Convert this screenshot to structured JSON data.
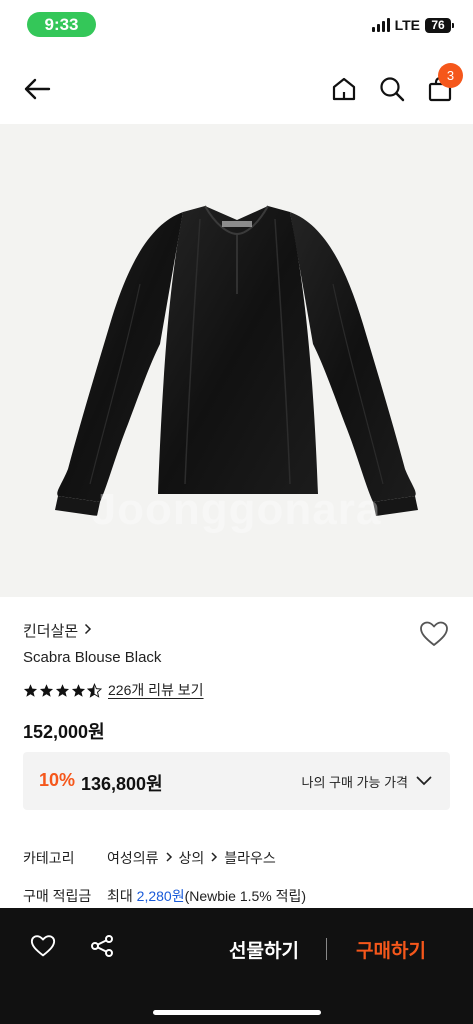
{
  "status_bar": {
    "time": "9:33",
    "network": "LTE",
    "battery": "76"
  },
  "header": {
    "cart_count": "3"
  },
  "image": {
    "watermark": "Joonggonara"
  },
  "product": {
    "brand": "킨더살몬",
    "name": "Scabra Blouse Black",
    "rating": 4.5,
    "review_link": "226개 리뷰 보기",
    "price": "152,000원"
  },
  "discount": {
    "rate": "10%",
    "price": "136,800원",
    "dropdown_label": "나의 구매 가능 가격"
  },
  "category": {
    "label": "카테고리",
    "path": [
      "여성의류",
      "상의",
      "블라우스"
    ]
  },
  "points": {
    "label": "구매 적립금",
    "prefix": "최대 ",
    "amount": "2,280원",
    "note": "(Newbie 1.5% 적립)"
  },
  "bottom_bar": {
    "gift_label": "선물하기",
    "buy_label": "구매하기"
  },
  "colors": {
    "accent": "#f5571b",
    "link_blue": "#1a5bd9",
    "status_green": "#34c759"
  }
}
